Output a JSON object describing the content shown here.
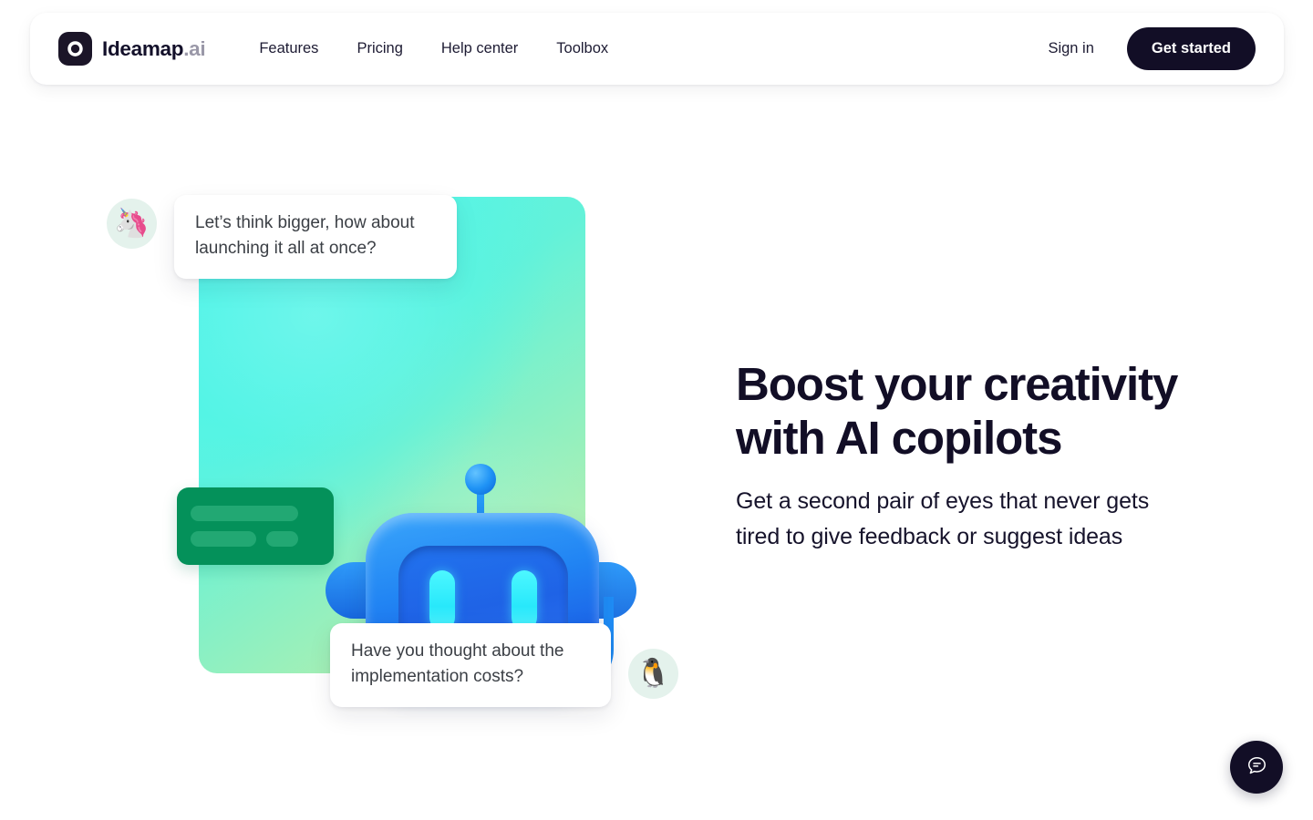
{
  "header": {
    "brand": {
      "name": "Ideamap",
      "tld": ".ai",
      "logo_icon": "ideamap-ring-logo-icon"
    },
    "nav": [
      {
        "label": "Features"
      },
      {
        "label": "Pricing"
      },
      {
        "label": "Help center"
      },
      {
        "label": "Toolbox"
      }
    ],
    "sign_in_label": "Sign in",
    "cta_label": "Get started",
    "colors": {
      "cta_bg": "#120e26",
      "cta_text": "#ffffff",
      "text": "#1d1b33"
    }
  },
  "hero": {
    "title_line1": "Boost your creativity",
    "title_line2": "with AI copilots",
    "subtitle_line1": "Get a second pair of eyes that never gets",
    "subtitle_line2": "tired to give feedback or suggest ideas",
    "title_color": "#120e26"
  },
  "illustration": {
    "gradient_colors": {
      "start": "#55f5ea",
      "mid": "#63f2d9",
      "end": "#c7f3a4"
    },
    "robot": {
      "icon": "robot-head-icon",
      "body_color": "#2184f3",
      "eye_color": "#35ecfb",
      "mouth_color": "#3f3f41"
    },
    "green_card": {
      "icon": "text-placeholder-card-icon",
      "bg": "#04915a",
      "bar": "#22a873"
    },
    "messages": [
      {
        "avatar_icon": "unicorn-avatar-icon",
        "avatar_glyph": "🦄",
        "text": "Let’s think bigger, how about launching it all at once?"
      },
      {
        "avatar_icon": "penguin-avatar-icon",
        "avatar_glyph": "🐧",
        "text": "Have you thought about the implementation costs?"
      }
    ]
  },
  "chat_widget": {
    "icon": "chat-bubble-icon",
    "bg": "#120e26"
  }
}
